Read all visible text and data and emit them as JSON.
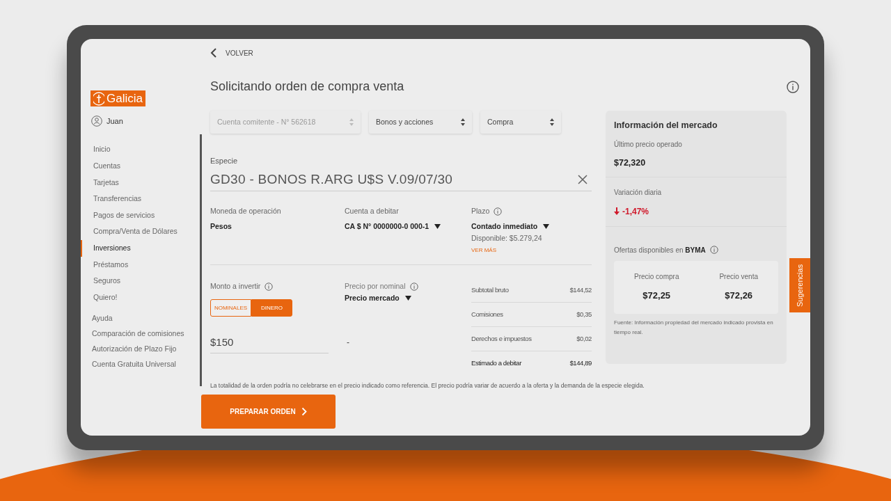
{
  "back_link": "VOLVER",
  "logo": "Galicia",
  "user": "Juan",
  "sidebar": {
    "items": [
      {
        "label": "Inicio",
        "selected": false
      },
      {
        "label": "Cuentas",
        "selected": false
      },
      {
        "label": "Tarjetas",
        "selected": false
      },
      {
        "label": "Transferencias",
        "selected": false
      },
      {
        "label": "Pagos de servicios",
        "selected": false
      },
      {
        "label": "Compra/Venta de Dólares",
        "selected": false
      },
      {
        "label": "Inversiones",
        "selected": true
      },
      {
        "label": "Préstamos",
        "selected": false
      },
      {
        "label": "Seguros",
        "selected": false
      },
      {
        "label": "Quiero!",
        "selected": false
      }
    ],
    "secondary_items": [
      {
        "label": "Ayuda"
      },
      {
        "label": "Comparación de comisiones"
      },
      {
        "label": "Autorización de Plazo Fijo"
      },
      {
        "label": "Cuenta Gratuita Universal"
      }
    ]
  },
  "title": "Solicitando orden de compra venta",
  "filters": [
    {
      "value": "Cuenta comitente - N° 562618",
      "disabled": true
    },
    {
      "value": "Bonos y acciones",
      "disabled": false
    },
    {
      "value": "Compra",
      "disabled": false
    }
  ],
  "especie": {
    "label": "Especie",
    "value": "GD30 - BONOS R.ARG U$S V.09/07/30"
  },
  "details": [
    {
      "label": "Moneda de operación",
      "info": false,
      "value": "Pesos",
      "dropdown": false
    },
    {
      "label": "Cuenta a debitar",
      "info": false,
      "value": "CA $ N° 0000000-0 000-1",
      "dropdown": true
    },
    {
      "label": "Plazo",
      "info": true,
      "value": "Contado inmediato",
      "dropdown": true,
      "note": "Disponible: $5.279,24",
      "link": "VER MÁS"
    }
  ],
  "monto": {
    "label": "Monto a invertir",
    "info": true,
    "toggle": [
      {
        "label": "NOMINALES",
        "selected": false
      },
      {
        "label": "DINERO",
        "selected": true
      }
    ],
    "value": "$150"
  },
  "precio": {
    "label": "Precio por nominal",
    "info": true,
    "value": "Precio mercado",
    "dropdown": true,
    "result": "-"
  },
  "summary": [
    {
      "label": "Subtotal bruto",
      "value": "$144,52",
      "total": false
    },
    {
      "label": "Comisiones",
      "value": "$0,35",
      "total": false
    },
    {
      "label": "Derechos e impuestos",
      "value": "$0,02",
      "total": false
    },
    {
      "label": "Estimado a debitar",
      "value": "$144,89",
      "total": true
    }
  ],
  "disclaimer": "La totalidad de la orden podría no celebrarse en el precio indicado como referencia. El precio podría variar de acuerdo a la oferta y la demanda de la especie elegida.",
  "submit": "PREPARAR ORDEN",
  "market": {
    "title": "Información del mercado",
    "last_price_label": "Último precio operado",
    "last_price": "$72,320",
    "variation_label": "Variación diaria",
    "variation": {
      "value": "-1,47%",
      "negative": true
    },
    "offers_label": "Ofertas disponibles en **BYMA**",
    "offers": [
      {
        "label": "Precio compra",
        "value": "$72,25"
      },
      {
        "label": "Precio venta",
        "value": "$72,26"
      }
    ],
    "source": "Fuente: Información propiedad del mercado indicado provista en tiempo real."
  },
  "suggestions": "Sugerencias"
}
